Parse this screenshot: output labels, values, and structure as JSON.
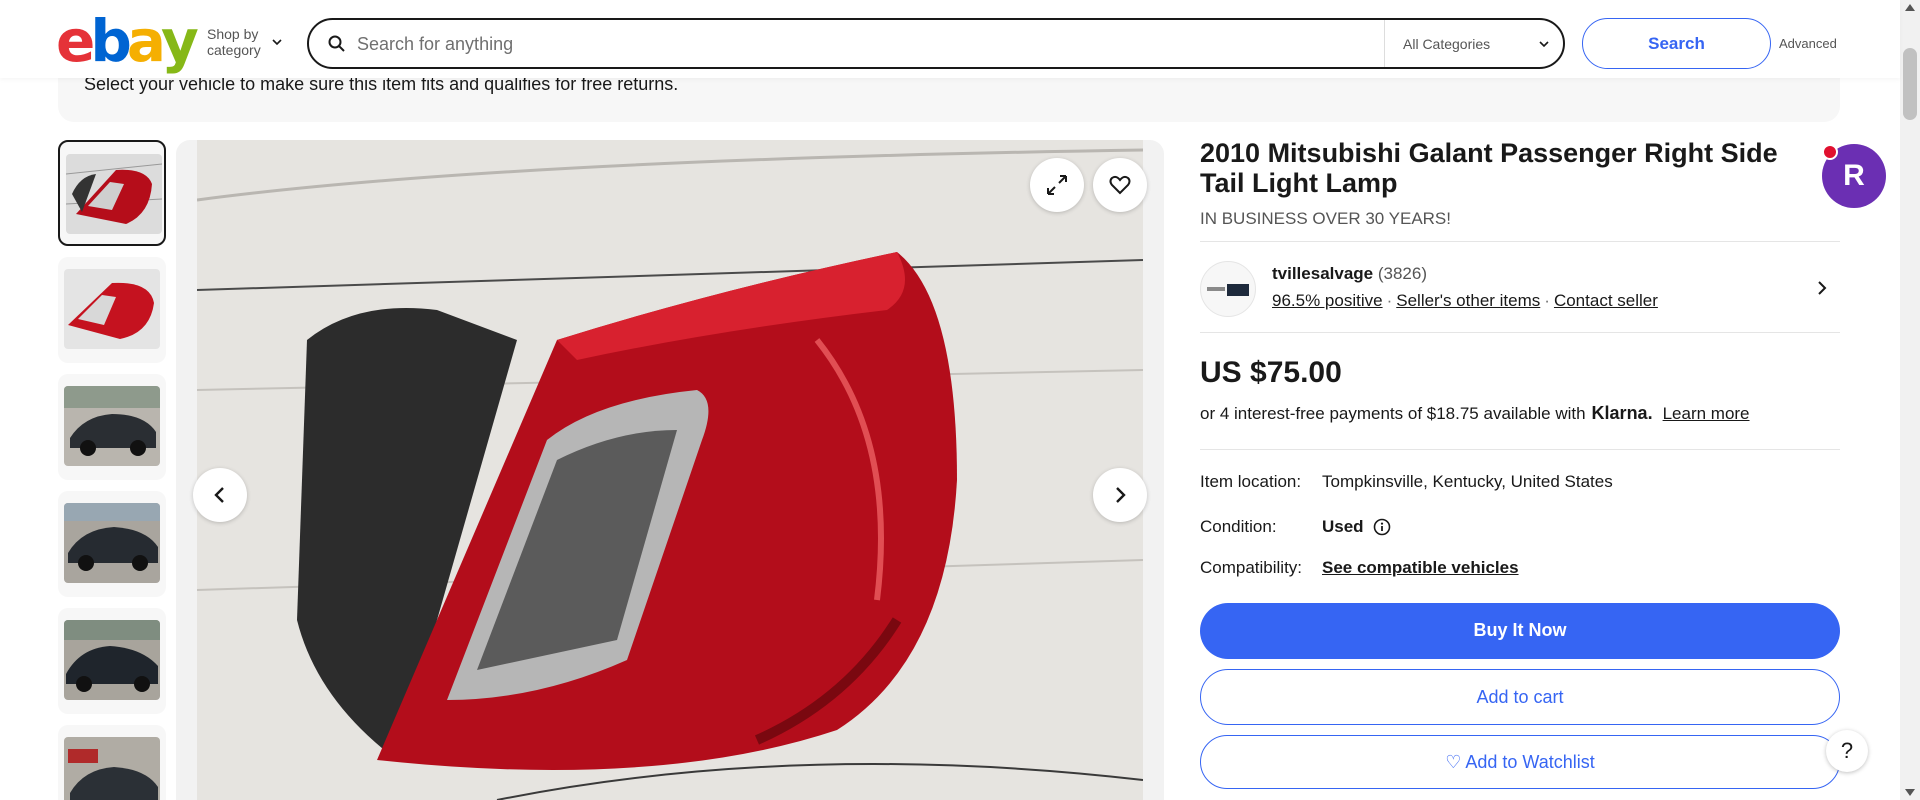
{
  "header": {
    "logo_letters": [
      {
        "char": "e",
        "color": "#e53238"
      },
      {
        "char": "b",
        "color": "#0064d2"
      },
      {
        "char": "a",
        "color": "#f5af02"
      },
      {
        "char": "y",
        "color": "#86b817"
      }
    ],
    "shop_by_line1": "Shop by",
    "shop_by_line2": "category",
    "search_placeholder": "Search for anything",
    "category_select": "All Categories",
    "search_button": "Search",
    "advanced_link": "Advanced"
  },
  "banner": {
    "text": "Select your vehicle to make sure this item fits and qualifies for free returns."
  },
  "gallery": {
    "thumbnail_count": 6,
    "selected_index": 0
  },
  "product": {
    "title": "2010 Mitsubishi Galant Passenger Right Side Tail Light Lamp",
    "subtitle": "IN BUSINESS OVER 30 YEARS!"
  },
  "seller": {
    "name": "tvillesalvage",
    "feedback_count": "(3826)",
    "positive": "96.5% positive",
    "other_items": "Seller's other items",
    "contact": "Contact seller"
  },
  "pricing": {
    "price": "US $75.00",
    "klarna_text": "or 4 interest-free payments of $18.75 available with",
    "klarna_brand": "Klarna.",
    "learn_more": "Learn more"
  },
  "specs": {
    "location_label": "Item location:",
    "location_value": "Tompkinsville, Kentucky, United States",
    "condition_label": "Condition:",
    "condition_value": "Used",
    "compat_label": "Compatibility:",
    "compat_value": "See compatible vehicles"
  },
  "actions": {
    "buy_now": "Buy It Now",
    "add_to_cart": "Add to cart",
    "watchlist": "♡ Add to Watchlist"
  },
  "floating": {
    "avatar_letter": "R",
    "help": "?"
  },
  "colors": {
    "accent": "#3665f3",
    "text": "#191919"
  }
}
